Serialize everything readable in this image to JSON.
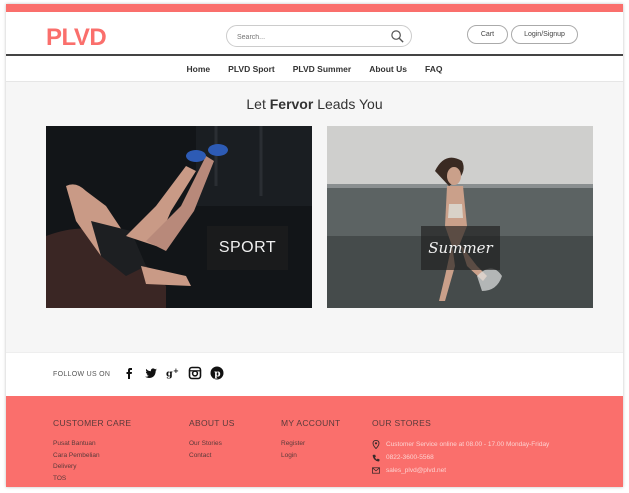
{
  "brand": {
    "logo": "PLVD",
    "accent": "#fa6f6c"
  },
  "header": {
    "search_placeholder": "Search...",
    "cart_label": "Cart",
    "login_label": "Login/Signup"
  },
  "nav": {
    "items": [
      {
        "label": "Home"
      },
      {
        "label": "PLVD Sport"
      },
      {
        "label": "PLVD Summer"
      },
      {
        "label": "About Us"
      },
      {
        "label": "FAQ"
      }
    ]
  },
  "hero": {
    "tagline_pre": "Let ",
    "tagline_bold": "Fervor",
    "tagline_post": " Leads You"
  },
  "tiles": {
    "sport_label": "SPORT",
    "summer_label": "Summer"
  },
  "social": {
    "follow_label": "FOLLOW US ON",
    "icons": [
      "facebook-icon",
      "twitter-icon",
      "google-plus-icon",
      "instagram-icon",
      "pinterest-icon"
    ]
  },
  "footer": {
    "customer_care": {
      "title": "CUSTOMER CARE",
      "links": [
        "Pusat Bantuan",
        "Cara Pembelian",
        "Delivery",
        "TOS"
      ]
    },
    "about_us": {
      "title": "ABOUT US",
      "links": [
        "Our Stories",
        "Contact"
      ]
    },
    "my_account": {
      "title": "MY ACCOUNT",
      "links": [
        "Register",
        "Login"
      ]
    },
    "our_stores": {
      "title": "OUR STORES",
      "service": "Customer Service online at 08.00 - 17.00 Monday-Friday",
      "phone": "0822-3600-5568",
      "email": "sales_plvd@plvd.net"
    }
  }
}
